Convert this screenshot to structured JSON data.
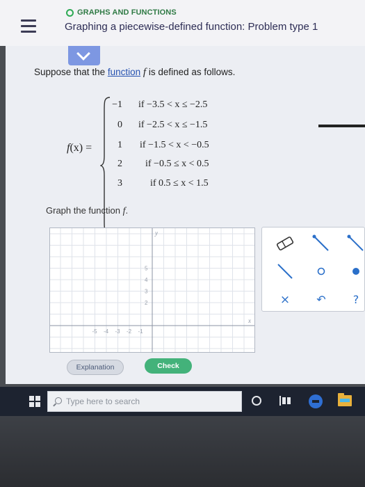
{
  "header": {
    "topic": "GRAPHS AND FUNCTIONS",
    "title": "Graphing a piecewise-defined function: Problem type 1",
    "menu_icon": "hamburger-menu-icon",
    "status_icon": "circle-outline-icon",
    "colors": {
      "topic_green": "#2eaa55",
      "title_navy": "#2d2d55"
    }
  },
  "collapse_tab": {
    "icon": "chevron-down-icon",
    "color": "#7d97e2"
  },
  "problem": {
    "prompt_before": "Suppose that the ",
    "prompt_link": "function",
    "prompt_var": "f",
    "prompt_after": " is defined as follows.",
    "function_label_var": "f",
    "function_label_rest": "(x) =",
    "cases": [
      {
        "value": "−1",
        "condition": "if −3.5 < x ≤ −2.5"
      },
      {
        "value": "0",
        "condition": "if −2.5 < x ≤ −1.5"
      },
      {
        "value": "1",
        "condition": "if −1.5 < x < −0.5"
      },
      {
        "value": "2",
        "condition": "if −0.5 ≤ x < 0.5"
      },
      {
        "value": "3",
        "condition": "if 0.5 ≤ x < 1.5"
      }
    ]
  },
  "graph": {
    "label_text": "Graph the function ",
    "label_var": "f",
    "label_end": ".",
    "y_axis_label": "y",
    "x_axis_label": "x",
    "y_ticks": [
      "5",
      "4",
      "3",
      "2"
    ],
    "x_ticks": [
      "-5",
      "-4",
      "-3",
      "-2",
      "-1"
    ],
    "x_range": [
      -5,
      5
    ],
    "y_range": [
      -5,
      5
    ],
    "grid": true
  },
  "tools": [
    {
      "name": "eraser-icon"
    },
    {
      "name": "segment-tool-icon"
    },
    {
      "name": "segment-closed-end-tool-icon"
    },
    {
      "name": "line-segment-tool-icon"
    },
    {
      "name": "open-point-icon"
    },
    {
      "name": "closed-point-icon"
    },
    {
      "name": "delete-x-icon"
    },
    {
      "name": "undo-icon"
    },
    {
      "name": "help-question-icon"
    }
  ],
  "tool_symbols": {
    "close": "×",
    "undo": "↶",
    "help": "?"
  },
  "actions": {
    "explanation_label": "Explanation",
    "check_label": "Check",
    "check_color": "#43b27a"
  },
  "taskbar": {
    "search_placeholder": "Type here to search",
    "icons": [
      "windows-start-icon",
      "search-icon",
      "cortana-icon",
      "task-view-icon",
      "edge-browser-icon",
      "file-explorer-icon"
    ]
  }
}
